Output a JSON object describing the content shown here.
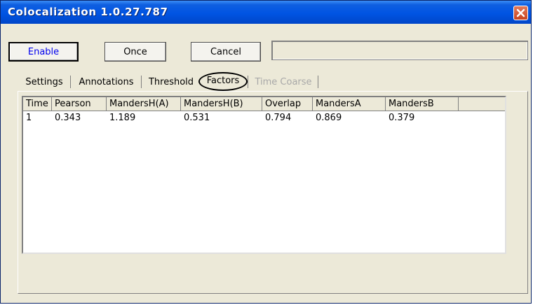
{
  "window": {
    "title": "Colocalization 1.0.27.787",
    "close_icon": "close-icon",
    "accent_color": "#0054e3",
    "close_color": "#c8441f"
  },
  "toolbar": {
    "enable_label": "Enable",
    "once_label": "Once",
    "cancel_label": "Cancel",
    "status_text": ""
  },
  "tabs": [
    {
      "label": "Settings",
      "enabled": true
    },
    {
      "label": "Annotations",
      "enabled": true
    },
    {
      "label": "Threshold",
      "enabled": true
    },
    {
      "label": "Factors",
      "enabled": true,
      "selected": true
    },
    {
      "label": "Time Coarse",
      "enabled": false
    }
  ],
  "table": {
    "columns": [
      "Time",
      "Pearson",
      "MandersH(A)",
      "MandersH(B)",
      "Overlap",
      "MandersA",
      "MandersB"
    ],
    "rows": [
      [
        "1",
        "0.343",
        "1.189",
        "0.531",
        "0.794",
        "0.869",
        "0.379"
      ]
    ]
  }
}
